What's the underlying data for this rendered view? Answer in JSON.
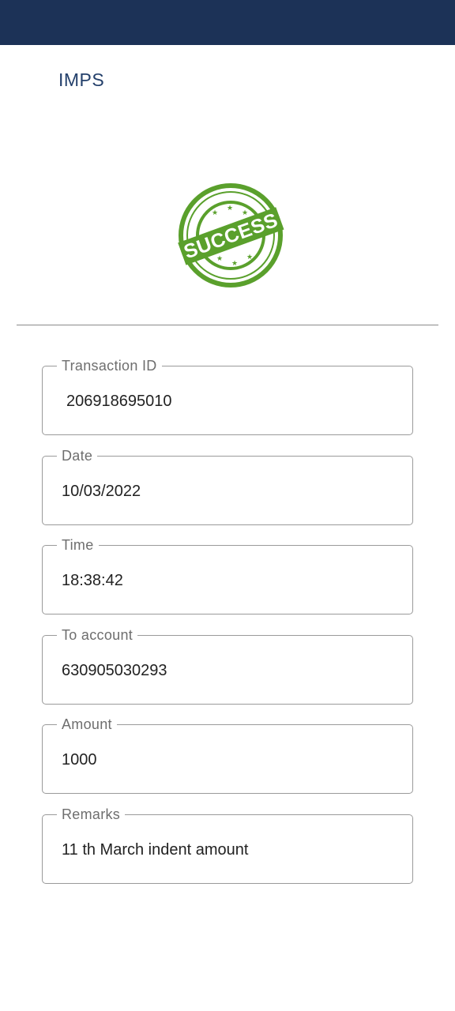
{
  "header": {
    "title": "IMPS",
    "status_color": "#1c3257"
  },
  "stamp": {
    "text": "SUCCESS",
    "icon": "success-stamp-icon",
    "color": "#5aa02c"
  },
  "fields": [
    {
      "label": "Transaction ID",
      "value": "206918695010"
    },
    {
      "label": "Date",
      "value": "10/03/2022"
    },
    {
      "label": "Time",
      "value": "18:38:42"
    },
    {
      "label": "To account",
      "value": "630905030293"
    },
    {
      "label": "Amount",
      "value": "1000"
    },
    {
      "label": "Remarks",
      "value": "11 th March indent amount"
    }
  ]
}
